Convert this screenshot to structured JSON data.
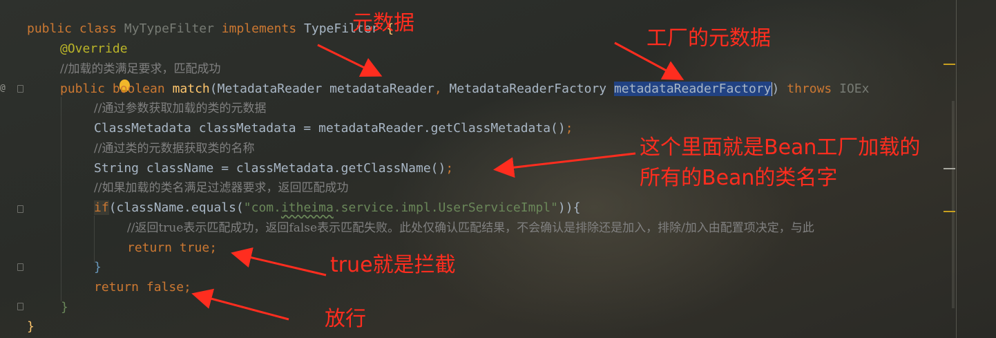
{
  "code": {
    "l1": {
      "kw1": "public",
      "kw2": "class",
      "name": "MyTypeFilter",
      "kw3": "implements",
      "iface": "TypeFilter",
      "brace": "{"
    },
    "l2": {
      "annotation": "@Override"
    },
    "l3": {
      "comment": "//加载的类满足要求，匹配成功"
    },
    "l4": {
      "kw1": "public",
      "kw2": "boolean",
      "method": "match",
      "p1": "(MetadataReader metadataReader",
      "comma": ",",
      "p2": " MetadataReaderFactory ",
      "selected": "metadataReaderFactory",
      "close": ")",
      "kw3": "throws",
      "exc": "IOEx"
    },
    "l5": {
      "comment": "//通过参数获取加载的类的元数据"
    },
    "l6": {
      "text": "ClassMetadata classMetadata = metadataReader.getClassMetadata()",
      "semi": ";"
    },
    "l7": {
      "comment": "//通过类的元数据获取类的名称"
    },
    "l8": {
      "text": "String className = classMetadata.getClassName()",
      "semi": ";"
    },
    "l9": {
      "comment": "//如果加载的类名满足过滤器要求，返回匹配成功"
    },
    "l10": {
      "kw": "if",
      "pre": "(className.equals(",
      "q1": "\"com.",
      "sq": "itheima",
      "q2": ".service.impl.UserServiceImpl\"",
      "post": ")){"
    },
    "l11": {
      "comment": "//返回true表示匹配成功，返回false表示匹配失败。此处仅确认匹配结果，不会确认是排除还是加入，排除/加入由配置项决定，与此"
    },
    "l12": {
      "kw": "return true",
      "semi": ";"
    },
    "l13": {
      "brace": "}"
    },
    "l14": {
      "kw": "return false",
      "semi": ";"
    },
    "l15": {
      "brace": "}"
    },
    "l16": {
      "brace": "}"
    }
  },
  "gutter": {
    "override_marker": "@"
  },
  "annotations": {
    "metadata": "元数据",
    "factory_metadata": "工厂的元数据",
    "bean_names_1": "这个里面就是Bean工厂加载的",
    "bean_names_2": "所有的Bean的类名字",
    "true_intercept": "true就是拦截",
    "release": "放行"
  },
  "colors": {
    "annotation_red": "#ff2d1f",
    "keyword": "#cc7832",
    "string": "#6a8759",
    "method": "#ffc66d",
    "selection": "#214283"
  }
}
